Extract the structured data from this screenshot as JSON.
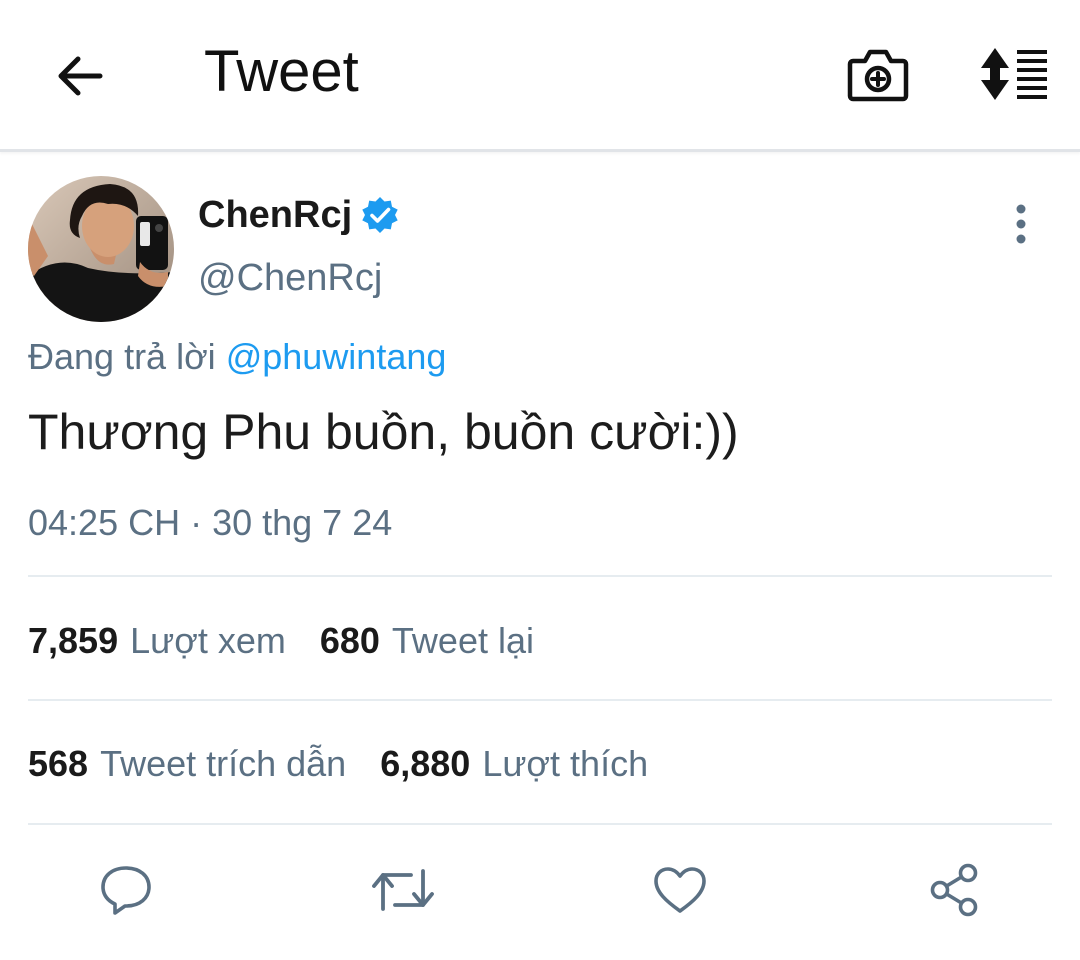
{
  "header": {
    "title": "Tweet",
    "icons": [
      "back-arrow-icon",
      "camera-add-icon",
      "sort-list-icon"
    ]
  },
  "author": {
    "name": "ChenRcj",
    "handle": "@ChenRcj",
    "verified": true,
    "verified_color": "#1d9bf0"
  },
  "tweet": {
    "reply_prefix": "Đang trả lời",
    "reply_mention": "@phuwintang",
    "text": "Thương Phu buồn, buồn cười:))",
    "timestamp": "04:25 CH · 30 thg 7 24"
  },
  "stats": {
    "views_count": "7,859",
    "views_label": "Lượt xem",
    "retweets_count": "680",
    "retweets_label": "Tweet lại",
    "quotes_count": "568",
    "quotes_label": "Tweet trích dẫn",
    "likes_count": "6,880",
    "likes_label": "Lượt thích"
  },
  "actions": [
    "reply-icon",
    "retweet-icon",
    "like-icon",
    "share-icon"
  ],
  "colors": {
    "accent": "#1d9bf0",
    "secondary_text": "#5b7083",
    "icon": "#5b7083",
    "divider": "#e6ecf0"
  }
}
